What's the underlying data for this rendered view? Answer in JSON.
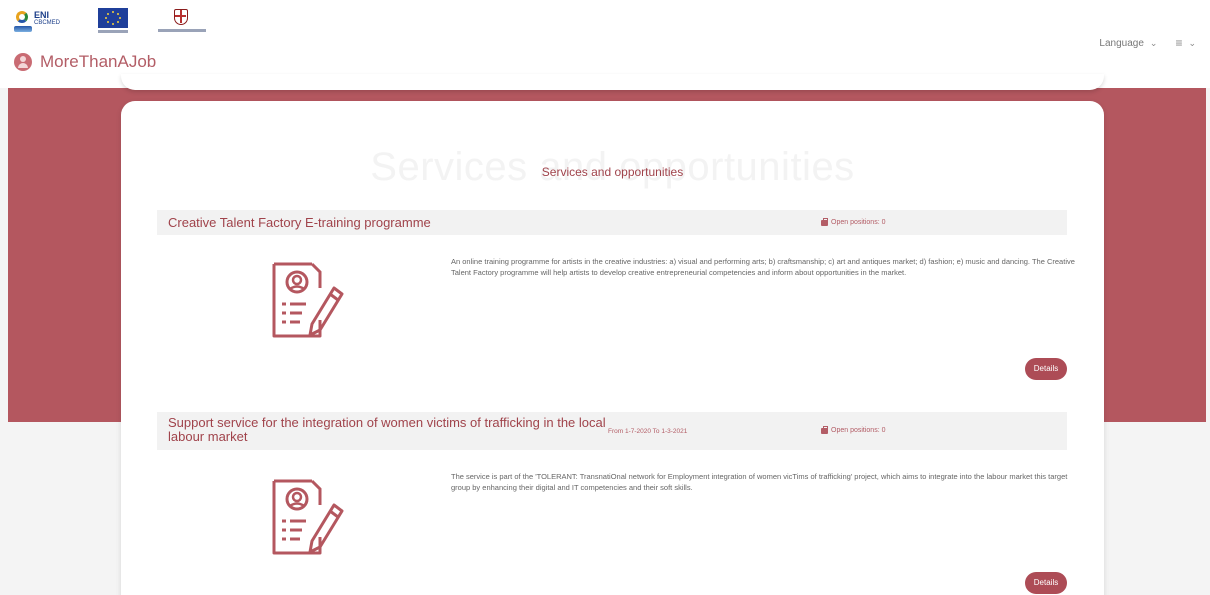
{
  "header": {
    "logos": {
      "eni": {
        "text": "ENI",
        "sub": "CBCMED"
      }
    },
    "brand_name": "MoreThanAJob",
    "language_label": "Language"
  },
  "main": {
    "background_title": "Services and opportunities",
    "section_title": "Services and opportunities",
    "services": [
      {
        "title": "Creative Talent Factory E-training programme",
        "dates": "",
        "open_positions": "Open positions: 0",
        "description": "An online training programme for artists in the creative industries: a) visual and performing arts; b) craftsmanship; c) art and antiques market; d) fashion; e) music and dancing. The Creative Talent Factory programme will help artists to develop creative entrepreneurial competencies and inform about opportunities in the market.",
        "button": "Details"
      },
      {
        "title": "Support service for the integration of women victims of trafficking in the local labour market",
        "dates": "From 1-7-2020 To 1-3-2021",
        "open_positions": "Open positions: 0",
        "description": "The service is part of the 'TOLERANT: TransnatiOnal network for Employment integration of women vicTims of trafficking' project, which aims to integrate into the labour market this target group by enhancing their digital and IT competencies and their soft skills.",
        "button": "Details"
      }
    ]
  },
  "colors": {
    "accent": "#b4575f",
    "title": "#a0434b",
    "button": "#ad4c56"
  },
  "icons": [
    "brand-user-icon",
    "chevron-down-icon",
    "hamburger-menu-icon",
    "briefcase-icon",
    "document-pen-icon"
  ]
}
